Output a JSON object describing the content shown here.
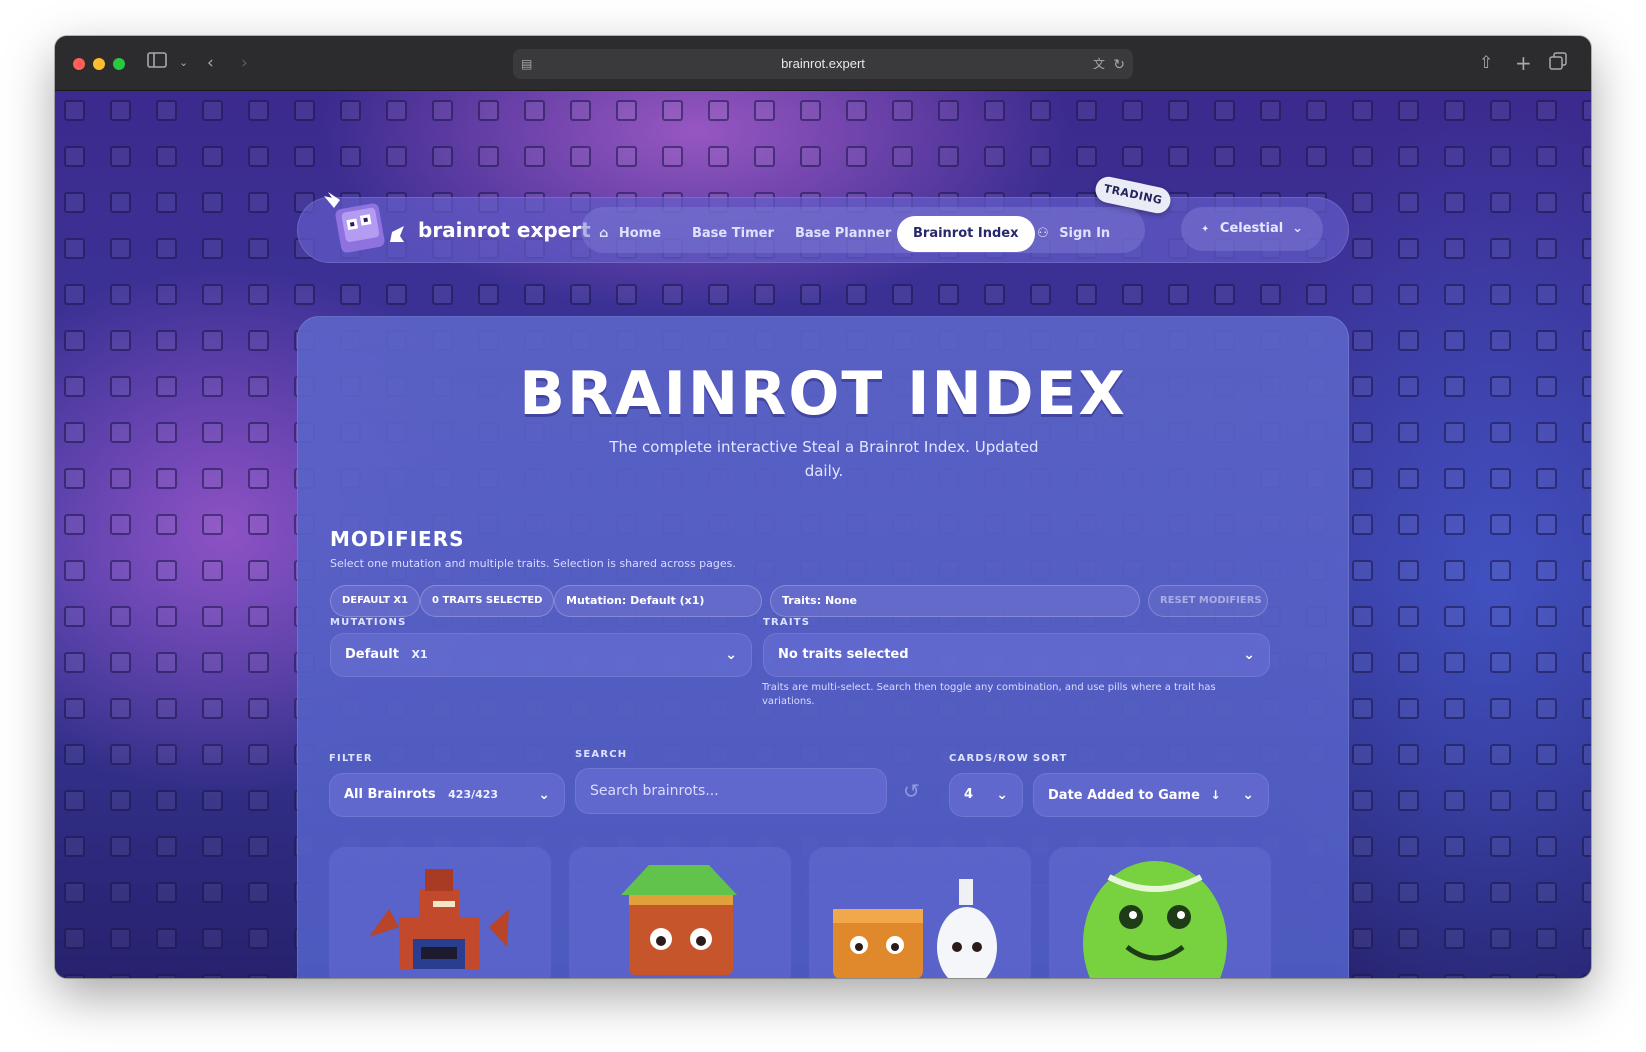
{
  "browser": {
    "url": "brainrot.expert",
    "traffic_colors": [
      "#ff5f57",
      "#febc2e",
      "#28c840"
    ]
  },
  "nav": {
    "brand": "brainrot expert",
    "items": [
      {
        "label": "Home",
        "icon": "home-icon"
      },
      {
        "label": "Base Timer"
      },
      {
        "label": "Base Planner"
      },
      {
        "label": "Brainrot Index",
        "active": true
      },
      {
        "label": "Sign In",
        "icon": "user-icon"
      }
    ],
    "trading_badge": "TRADING",
    "theme_select": "Celestial"
  },
  "page": {
    "title": "BRAINROT INDEX",
    "subtitle": "The complete interactive Steal a Brainrot Index. Updated daily."
  },
  "modifiers": {
    "title": "MODIFIERS",
    "description": "Select one mutation and multiple traits. Selection is shared across pages.",
    "chips": {
      "default": "DEFAULT X1",
      "traits_selected": "0 TRAITS SELECTED",
      "mutation": "Mutation: Default (x1)",
      "traits": "Traits: None",
      "reset": "RESET MODIFIERS"
    },
    "mutations_label": "MUTATIONS",
    "mutation_value": "Default",
    "mutation_multiplier": "X1",
    "traits_label": "TRAITS",
    "traits_value": "No traits selected",
    "traits_hint": "Traits are multi-select. Search then toggle any combination, and use pills where a trait has variations."
  },
  "controls": {
    "filter_label": "FILTER",
    "filter_value": "All Brainrots",
    "filter_count": "423/423",
    "search_label": "SEARCH",
    "search_placeholder": "Search brainrots...",
    "cards_label": "CARDS/ROW",
    "cards_value": "4",
    "sort_label": "SORT",
    "sort_value": "Date Added to Game"
  },
  "colors": {
    "accent": "#5b63c6",
    "active_nav_bg": "#ffffff",
    "active_nav_text": "#27286b"
  }
}
